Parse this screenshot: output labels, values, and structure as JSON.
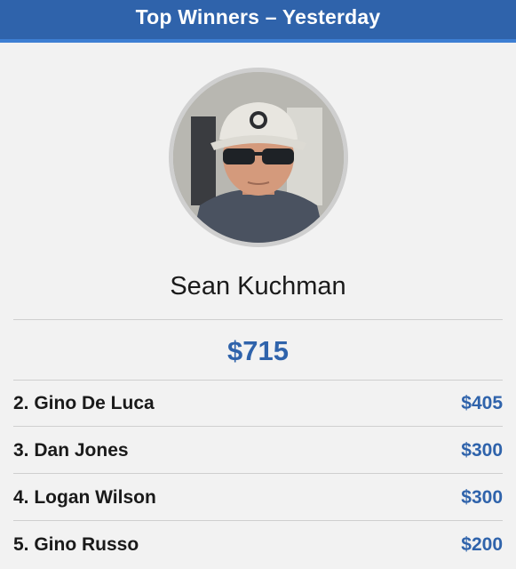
{
  "header": {
    "title": "Top Winners – Yesterday"
  },
  "colors": {
    "header": "#2f63ab",
    "accent": "#2f63ab",
    "divider": "#cfcfcf",
    "background": "#f2f2f2"
  },
  "top_winner": {
    "name": "Sean Kuchman",
    "amount": "$715",
    "avatar": "profile-photo"
  },
  "list": [
    {
      "rank_name": "2. Gino De Luca",
      "amount": "$405"
    },
    {
      "rank_name": "3. Dan Jones",
      "amount": "$300"
    },
    {
      "rank_name": "4. Logan Wilson",
      "amount": "$300"
    },
    {
      "rank_name": "5. Gino Russo",
      "amount": "$200"
    }
  ]
}
